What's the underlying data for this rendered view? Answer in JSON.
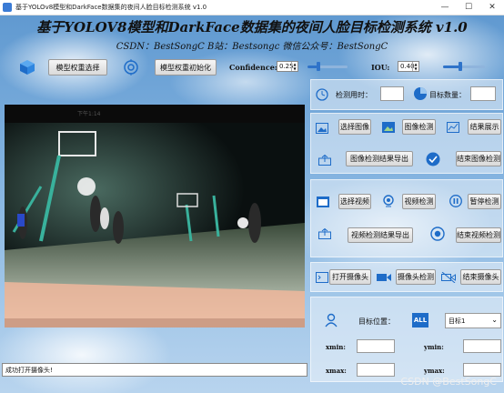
{
  "window": {
    "title": "基于YOLOv8模型和DarkFace数据集的夜间人脸目标检测系统 v1.0",
    "minimize": "—",
    "maximize": "☐",
    "close": "✕"
  },
  "header": {
    "main_title": "基于YOLOV8模型和DarkFace数据集的夜间人脸目标检测系统 v1.0",
    "subtitle": "CSDN：BestSongC   B站：Bestsongc   微信公众号：BestSongC"
  },
  "toolbar": {
    "select_weights": "模型权重选择",
    "init_weights": "模型权重初始化",
    "confidence_label": "Confidence:",
    "confidence_value": "0.25",
    "confidence_level": 0.25,
    "iou_label": "IOU:",
    "iou_value": "0.40",
    "iou_level": 0.4
  },
  "stats": {
    "time_label": "检测用时：",
    "time_value": "",
    "count_label": "目标数量：",
    "count_value": ""
  },
  "image_section": {
    "select_image": "选择图像",
    "detect_image": "图像检测",
    "show_result": "结果展示",
    "export_image": "图像检测结果导出",
    "stop_image": "结束图像检测"
  },
  "video_section": {
    "select_video": "选择视频",
    "detect_video": "视频检测",
    "pause_video": "暂停检测",
    "export_video": "视频检测结果导出",
    "stop_video": "结束视频检测"
  },
  "camera_section": {
    "open_camera": "打开摄像头",
    "detect_camera": "摄像头检测",
    "close_camera": "结束摄像头"
  },
  "target_section": {
    "position_label": "目标位置：",
    "all_icon": "ALL",
    "target_select": "目标1",
    "xmin": "xmin:",
    "ymin": "ymin:",
    "xmax": "xmax:",
    "ymax": "ymax:"
  },
  "status_bar": {
    "message": "成功打开摄像头!"
  },
  "watermark": "CSDN @BestSongC",
  "video_preview": {
    "phone_top_text": "下午1:14"
  }
}
